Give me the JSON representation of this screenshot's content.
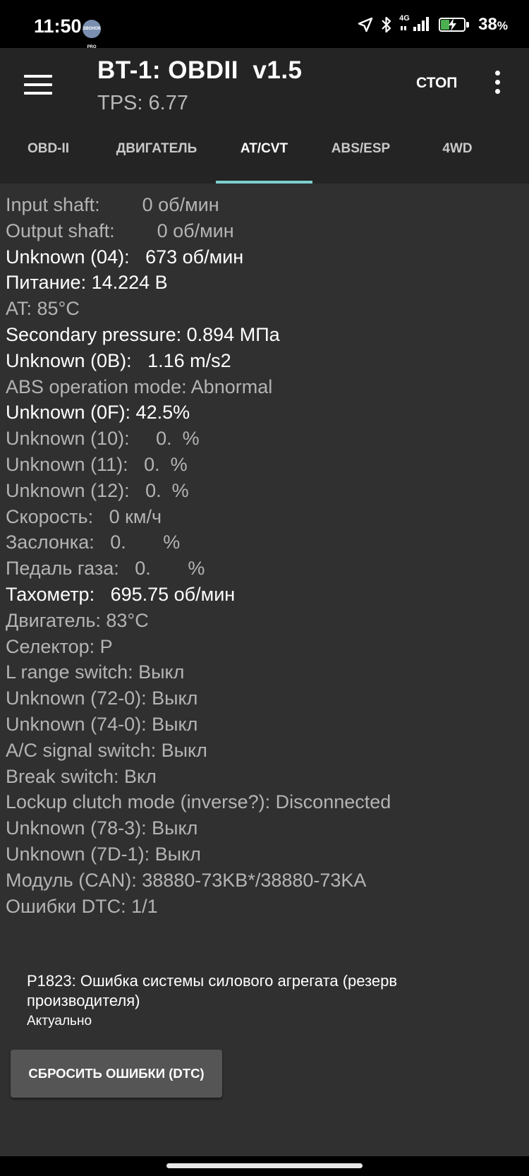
{
  "status_bar": {
    "time": "11:50",
    "badge": "ЗВОНОК PRO",
    "network": "4G",
    "battery_percent": "38",
    "battery_percent_sign": "%",
    "battery_level": 0.38,
    "colors": {
      "battery_charge": "#4caf50"
    }
  },
  "app_bar": {
    "title": "BT-1: OBDII  v1.5",
    "subtitle": "TPS: 6.77",
    "stop_label": "СТОП"
  },
  "tabs": [
    {
      "label": "OBD-II",
      "active": false
    },
    {
      "label": "ДВИГАТЕЛЬ",
      "active": false
    },
    {
      "label": "AT/CVT",
      "active": true
    },
    {
      "label": "ABS/ESP",
      "active": false
    },
    {
      "label": "4WD",
      "active": false
    }
  ],
  "readings": [
    {
      "text": "Input shaft:        0 об/мин",
      "highlight": false
    },
    {
      "text": "Output shaft:        0 об/мин",
      "highlight": false
    },
    {
      "text": "Unknown (04):   673 об/мин",
      "highlight": true
    },
    {
      "text": "Питание: 14.224 В",
      "highlight": true
    },
    {
      "text": "AT: 85°C",
      "highlight": false
    },
    {
      "text": "Secondary pressure: 0.894 МПа",
      "highlight": true
    },
    {
      "text": "Unknown (0B):   1.16 m/s2",
      "highlight": true
    },
    {
      "text": "ABS operation mode: Abnormal",
      "highlight": false
    },
    {
      "text": "Unknown (0F): 42.5%",
      "highlight": true
    },
    {
      "text": "Unknown (10):     0.  %",
      "highlight": false
    },
    {
      "text": "Unknown (11):   0.  %",
      "highlight": false
    },
    {
      "text": "Unknown (12):   0.  %",
      "highlight": false
    },
    {
      "text": "Скорость:   0 км/ч",
      "highlight": false
    },
    {
      "text": "Заслонка:   0.       %",
      "highlight": false
    },
    {
      "text": "Педаль газа:   0.       %",
      "highlight": false
    },
    {
      "text": "Тахометр:   695.75 об/мин",
      "highlight": true
    },
    {
      "text": "Двигатель: 83°C",
      "highlight": false
    },
    {
      "text": "Селектор: P",
      "highlight": false
    },
    {
      "text": "L range switch: Выкл",
      "highlight": false
    },
    {
      "text": "Unknown (72-0): Выкл",
      "highlight": false
    },
    {
      "text": "Unknown (74-0): Выкл",
      "highlight": false
    },
    {
      "text": "A/C signal switch: Выкл",
      "highlight": false
    },
    {
      "text": "Break switch: Вкл",
      "highlight": false
    },
    {
      "text": "Lockup clutch mode (inverse?): Disconnected",
      "highlight": false
    },
    {
      "text": "Unknown (78-3): Выкл",
      "highlight": false
    },
    {
      "text": "Unknown (7D-1): Выкл",
      "highlight": false
    },
    {
      "text": "Модуль (CAN): 38880-73KB*/38880-73KA",
      "highlight": false
    },
    {
      "text": "Ошибки DTC: 1/1",
      "highlight": false
    }
  ],
  "dtc": {
    "code_text": "P1823: Ошибка системы силового агрегата (резерв производителя)",
    "status": "Актуально"
  },
  "reset_button_label": "СБРОСИТЬ ОШИБКИ (DTC)"
}
